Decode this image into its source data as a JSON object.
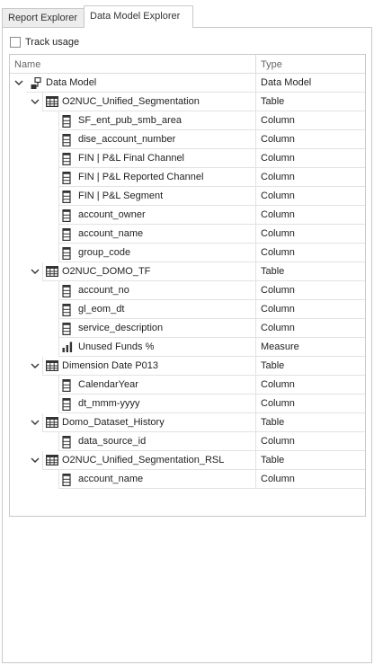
{
  "tabs": [
    {
      "label": "Report Explorer",
      "active": false
    },
    {
      "label": "Data Model Explorer",
      "active": true
    }
  ],
  "track_usage": {
    "label": "Track usage",
    "checked": false
  },
  "columns": {
    "name": "Name",
    "type": "Type"
  },
  "tree": [
    {
      "level": 0,
      "icon": "data-model-icon",
      "name": "Data Model",
      "type": "Data Model",
      "expandable": true
    },
    {
      "level": 1,
      "icon": "table-icon",
      "name": "O2NUC_Unified_Segmentation",
      "type": "Table",
      "expandable": true
    },
    {
      "level": 2,
      "icon": "column-icon",
      "name": "SF_ent_pub_smb_area",
      "type": "Column"
    },
    {
      "level": 2,
      "icon": "column-icon",
      "name": "dise_account_number",
      "type": "Column"
    },
    {
      "level": 2,
      "icon": "column-icon",
      "name": "FIN | P&L Final Channel",
      "type": "Column"
    },
    {
      "level": 2,
      "icon": "column-icon",
      "name": "FIN | P&L Reported Channel",
      "type": "Column"
    },
    {
      "level": 2,
      "icon": "column-icon",
      "name": "FIN | P&L Segment",
      "type": "Column"
    },
    {
      "level": 2,
      "icon": "column-icon",
      "name": "account_owner",
      "type": "Column"
    },
    {
      "level": 2,
      "icon": "column-icon",
      "name": "account_name",
      "type": "Column"
    },
    {
      "level": 2,
      "icon": "column-icon",
      "name": "group_code",
      "type": "Column"
    },
    {
      "level": 1,
      "icon": "table-icon",
      "name": "O2NUC_DOMO_TF",
      "type": "Table",
      "expandable": true
    },
    {
      "level": 2,
      "icon": "column-icon",
      "name": "account_no",
      "type": "Column"
    },
    {
      "level": 2,
      "icon": "column-icon",
      "name": "gl_eom_dt",
      "type": "Column"
    },
    {
      "level": 2,
      "icon": "column-icon",
      "name": "service_description",
      "type": "Column"
    },
    {
      "level": 2,
      "icon": "measure-icon",
      "name": "Unused Funds %",
      "type": "Measure"
    },
    {
      "level": 1,
      "icon": "table-icon",
      "name": "Dimension Date P013",
      "type": "Table",
      "expandable": true
    },
    {
      "level": 2,
      "icon": "column-icon",
      "name": "CalendarYear",
      "type": "Column"
    },
    {
      "level": 2,
      "icon": "column-icon",
      "name": "dt_mmm-yyyy",
      "type": "Column"
    },
    {
      "level": 1,
      "icon": "table-icon",
      "name": "Domo_Dataset_History",
      "type": "Table",
      "expandable": true
    },
    {
      "level": 2,
      "icon": "column-icon",
      "name": "data_source_id",
      "type": "Column"
    },
    {
      "level": 1,
      "icon": "table-icon",
      "name": "O2NUC_Unified_Segmentation_RSL",
      "type": "Table",
      "expandable": true
    },
    {
      "level": 2,
      "icon": "column-icon",
      "name": "account_name",
      "type": "Column"
    }
  ]
}
